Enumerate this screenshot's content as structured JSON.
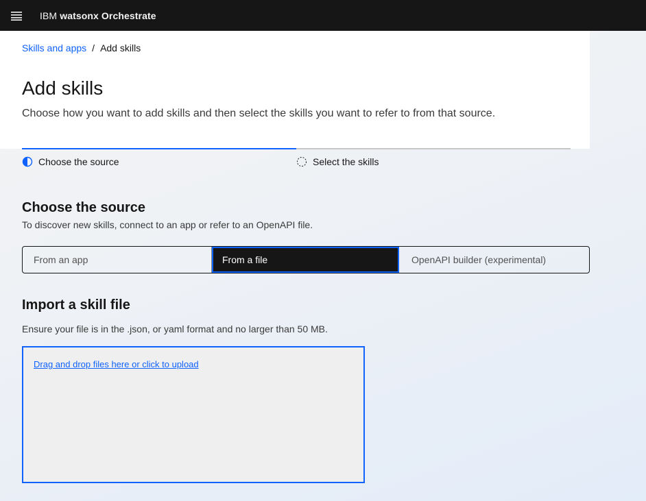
{
  "app": {
    "title_prefix": "IBM",
    "title_product": "watsonx Orchestrate"
  },
  "breadcrumb": {
    "parent": "Skills and apps",
    "separator": "/",
    "current": "Add skills"
  },
  "page": {
    "title": "Add skills",
    "description": "Choose how you want to add skills and then select the skills you want to refer to from that source."
  },
  "progress": {
    "steps": [
      {
        "label": "Choose the source",
        "state": "current"
      },
      {
        "label": "Select the skills",
        "state": "incomplete"
      }
    ]
  },
  "source": {
    "title": "Choose the source",
    "description": "To discover new skills, connect to an app or refer to an OpenAPI file.",
    "options": [
      "From an app",
      "From a file",
      "OpenAPI builder (experimental)"
    ],
    "selected": "From a file"
  },
  "import": {
    "title": "Import a skill file",
    "description": "Ensure your file is in the .json, or yaml format and no larger than 50 MB.",
    "dropzone_label": "Drag and drop files here or click to upload"
  },
  "colors": {
    "accent": "#0f62fe",
    "topbar": "#161616"
  }
}
